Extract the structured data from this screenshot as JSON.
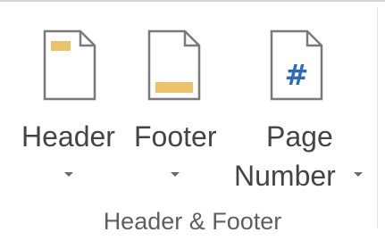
{
  "group": {
    "title": "Header & Footer"
  },
  "commands": {
    "header": {
      "label": "Header",
      "icon": "header-page-icon",
      "has_dropdown": true
    },
    "footer": {
      "label": "Footer",
      "icon": "footer-page-icon",
      "has_dropdown": true
    },
    "page_number": {
      "label_line1": "Page",
      "label_line2": "Number",
      "icon": "page-number-icon",
      "icon_glyph": "#",
      "has_dropdown": true
    }
  },
  "colors": {
    "accent_block": "#e9c46a",
    "page_outline": "#7a7a7a",
    "hash_blue": "#2b6cb8",
    "text": "#444444"
  }
}
